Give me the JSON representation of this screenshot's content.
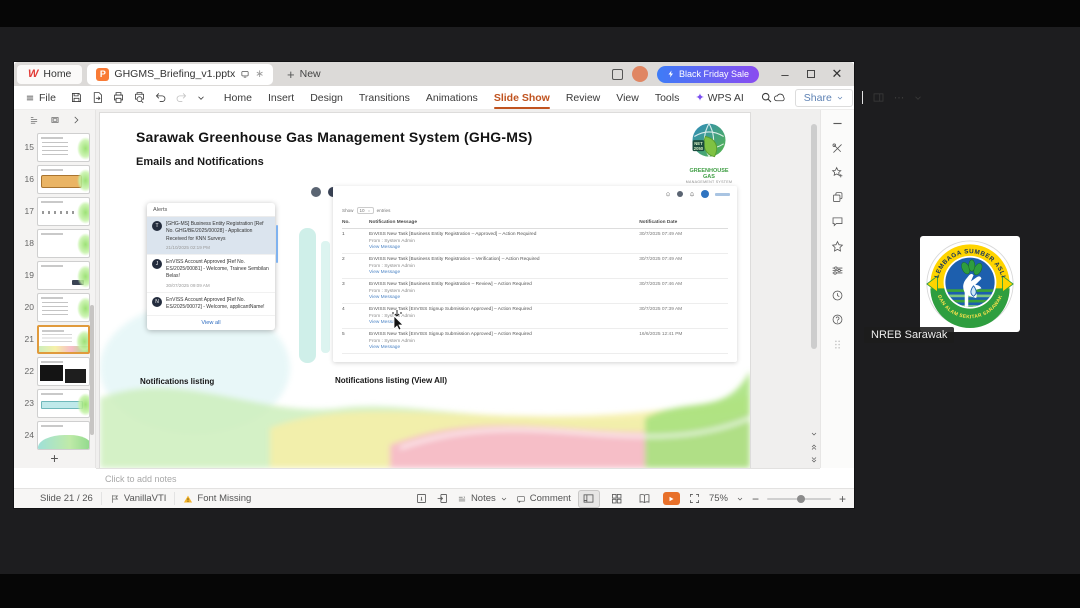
{
  "colors": {
    "accent_orange": "#c0531f",
    "black_friday_gradient_start": "#3e7cf7",
    "black_friday_gradient_end": "#8a4cf0",
    "selected_thumb_border": "#e09a3c",
    "play_button": "#e8702a",
    "alert_selected_bg": "#dbe4ee",
    "link_blue": "#2c6bc0"
  },
  "window": {
    "home_tab": "Home",
    "document_tab": "GHGMS_Briefing_v1.pptx",
    "new_tab": "New",
    "black_friday_sale": "Black Friday Sale",
    "file_menu": "File",
    "menu_items": [
      "Home",
      "Insert",
      "Design",
      "Transitions",
      "Animations",
      "Slide Show",
      "Review",
      "View",
      "Tools",
      "WPS AI"
    ],
    "active_menu": "Slide Show",
    "share_button": "Share"
  },
  "sidebar": {
    "thumbnails": [
      "15",
      "16",
      "17",
      "18",
      "19",
      "20",
      "21",
      "22",
      "23",
      "24"
    ],
    "selected": "21"
  },
  "slide": {
    "title": "Sarawak Greenhouse Gas Management System (GHG-MS)",
    "subtitle": "Emails and Notifications",
    "logo_badge_line1": "NET",
    "logo_badge_line2": "2050",
    "logo_text_top": "GREENHOUSE GAS",
    "logo_text_bottom": "MANAGEMENT SYSTEM",
    "alerts": {
      "header": "Alerts",
      "items": [
        {
          "avatar": "T",
          "text": "[GHG-MS] Business Entity Registration [Ref No. GHG/BE/2025/00028] - Application Received for KNN Surveys",
          "time": "21/10/2025 02:19 PM"
        },
        {
          "avatar": "J",
          "text": "EnVISS Account Approved [Ref No. ES/2025/00081] - Welcome, Trainee Sembilan Belas!",
          "time": "30/07/2025 09:09 AM"
        },
        {
          "avatar": "N",
          "text": "EnVISS Account Approved [Ref No. ES/2025/00072] - Welcome, applicantName!",
          "time": ""
        }
      ],
      "view_all": "View all"
    },
    "table": {
      "show_label": "Show",
      "show_value": "10",
      "entries_label": "entries",
      "headers": [
        "No.",
        "Notification Message",
        "Notification Date"
      ],
      "rows": [
        {
          "no": "1",
          "message": "EnVISS New Task [Business Entity Registration – Approved] – Action Required",
          "from": "From : System Admin",
          "link": "View Message",
          "date": "30/7/2025 07:49 AM"
        },
        {
          "no": "2",
          "message": "EnVISS New Task [Business Entity Registration – Verification] – Action Required",
          "from": "From : System Admin",
          "link": "View Message",
          "date": "30/7/2025 07:49 AM"
        },
        {
          "no": "3",
          "message": "EnVISS New Task [Business Entity Registration – Review] – Action Required",
          "from": "From : System Admin",
          "link": "View Message",
          "date": "30/7/2025 07:46 AM"
        },
        {
          "no": "4",
          "message": "EnVISS New Task [EnVISS Signup Submission Approved] – Action Required",
          "from": "From : System Admin",
          "link": "View Message",
          "date": "30/7/2025 07:39 AM"
        },
        {
          "no": "5",
          "message": "EnVISS New Task [EnVISS Signup Submission Approved] – Action Required",
          "from": "From : System Admin",
          "link": "View Message",
          "date": "16/6/2025 12:41 PM"
        }
      ]
    },
    "caption_left": "Notifications listing",
    "caption_right": "Notifications listing (View All)"
  },
  "notes_placeholder": "Click to add notes",
  "statusbar": {
    "slide_indicator": "Slide 21 / 26",
    "theme_name": "VanillaVTI",
    "font_missing": "Font Missing",
    "notes": "Notes",
    "comment": "Comment",
    "zoom_level": "75%"
  },
  "participant": {
    "name": "NREB Sarawak",
    "emblem_top": "LEMBAGA SUMBER ASLI",
    "emblem_bottom": "DAN ALAM SEKITAR SARAWAK"
  }
}
